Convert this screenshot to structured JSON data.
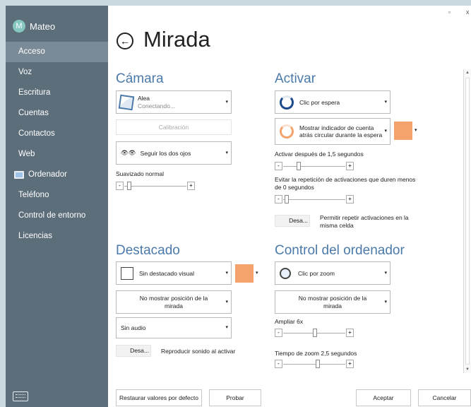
{
  "sidebar": {
    "user": {
      "name": "Mateo",
      "initial": "M"
    },
    "items": [
      {
        "label": "Acceso",
        "active": true
      },
      {
        "label": "Voz"
      },
      {
        "label": "Escritura"
      },
      {
        "label": "Cuentas"
      },
      {
        "label": "Contactos"
      },
      {
        "label": "Web"
      },
      {
        "label": "Ordenador"
      },
      {
        "label": "Teléfono"
      },
      {
        "label": "Control de entorno"
      },
      {
        "label": "Licencias"
      }
    ],
    "keyboard_icon": "keyboard-icon"
  },
  "window": {
    "minimize": "▫",
    "close": "x"
  },
  "header": {
    "back_icon": "back-arrow-icon",
    "title": "Mirada"
  },
  "camara": {
    "title": "Cámara",
    "device_name": "Alea",
    "device_status": "Conectando...",
    "calibration": "Calibración",
    "eyes": "Seguir los dos ojos",
    "smoothing_label": "Suavizado normal"
  },
  "activar": {
    "title": "Activar",
    "mode": "Clic por espera",
    "indicator_text": "Mostrar indicador de cuenta atrás circular durante la espera",
    "activate_after": "Activar después de 1,5 segundos",
    "avoid_repeat": "Evitar la repetición de activaciones que duren menos de 0 segundos",
    "toggle_label": "Desa...",
    "allow_repeat": "Permitir repetir activaciones en la misma celda"
  },
  "destacado": {
    "title": "Destacado",
    "highlight": "Sin destacado visual",
    "position": "No mostrar posición de la mirada",
    "audio": "Sin audio",
    "toggle_label": "Desa...",
    "sound_label": "Reproducir sonido al activar"
  },
  "control": {
    "title": "Control del ordenador",
    "mode": "Clic por zoom",
    "position": "No mostrar posición de la mirada",
    "zoom_label": "Ampliar 6x",
    "zoom_time": "Tiempo de zoom 2,5 segundos"
  },
  "footer": {
    "restore": "Restaurar valores por defecto",
    "test": "Probar",
    "accept": "Aceptar",
    "cancel": "Cancelar"
  },
  "colors": {
    "accent": "#f4a36c",
    "heading": "#4b7aaa",
    "sidebar": "#5d6e7b"
  }
}
